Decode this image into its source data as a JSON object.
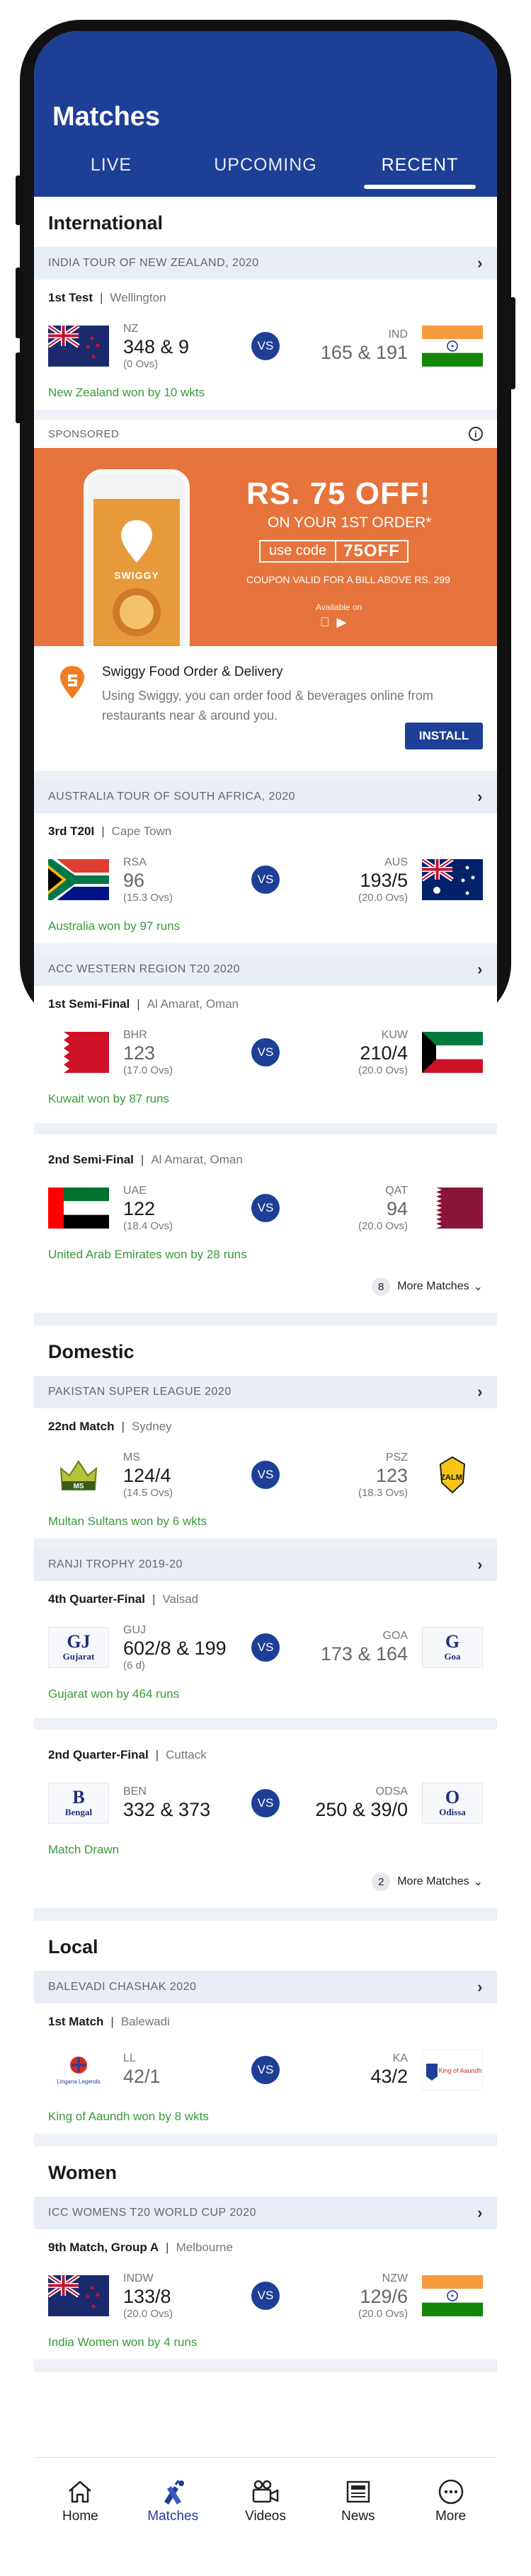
{
  "header": {
    "title": "Matches",
    "tabs": [
      "LIVE",
      "UPCOMING",
      "RECENT"
    ],
    "active_tab": "RECENT"
  },
  "sections": {
    "international": "International",
    "domestic": "Domestic",
    "local": "Local",
    "women": "Women"
  },
  "series": {
    "nz_tour": "INDIA TOUR OF NEW ZEALAND, 2020",
    "sa_tour": "AUSTRALIA TOUR OF SOUTH AFRICA, 2020",
    "acc": "ACC WESTERN REGION T20 2020",
    "psl": "PAKISTAN SUPER LEAGUE 2020",
    "ranji": "RANJI TROPHY 2019-20",
    "balewadi": "BALEVADI CHASHAK 2020",
    "icc_women": "ICC WOMENS T20 WORLD CUP 2020"
  },
  "matches": {
    "m1": {
      "name": "1st Test",
      "venue": "Wellington",
      "left_code": "NZ",
      "left_score": "348 & 9",
      "left_overs": "(0 Ovs)",
      "right_code": "IND",
      "right_score": "165 & 191",
      "right_overs": "",
      "result": "New Zealand won by 10 wkts"
    },
    "m2": {
      "name": "3rd T20I",
      "venue": "Cape Town",
      "left_code": "RSA",
      "left_score": "96",
      "left_overs": "(15.3 Ovs)",
      "right_code": "AUS",
      "right_score": "193/5",
      "right_overs": "(20.0 Ovs)",
      "result": "Australia won by 97 runs"
    },
    "m3": {
      "name": "1st Semi-Final",
      "venue": "Al Amarat, Oman",
      "left_code": "BHR",
      "left_score": "123",
      "left_overs": "(17.0 Ovs)",
      "right_code": "KUW",
      "right_score": "210/4",
      "right_overs": "(20.0 Ovs)",
      "result": "Kuwait won by 87 runs"
    },
    "m4": {
      "name": "2nd Semi-Final",
      "venue": "Al Amarat, Oman",
      "left_code": "UAE",
      "left_score": "122",
      "left_overs": "(18.4 Ovs)",
      "right_code": "QAT",
      "right_score": "94",
      "right_overs": "(20.0 Ovs)",
      "result": "United Arab Emirates won by 28 runs"
    },
    "m5": {
      "name": "22nd Match",
      "venue": "Sydney",
      "left_code": "MS",
      "left_score": "124/4",
      "left_overs": "(14.5 Ovs)",
      "right_code": "PSZ",
      "right_score": "123",
      "right_overs": "(18.3 Ovs)",
      "result": "Multan Sultans won by 6 wkts"
    },
    "m6": {
      "name": "4th Quarter-Final",
      "venue": "Valsad",
      "left_code": "GUJ",
      "left_score": "602/8 & 199",
      "left_overs": "(6 d)",
      "right_code": "GOA",
      "right_score": "173 & 164",
      "right_overs": "",
      "result": "Gujarat won by 464 runs"
    },
    "m7": {
      "name": "2nd Quarter-Final",
      "venue": "Cuttack",
      "left_code": "BEN",
      "left_score": "332 & 373",
      "left_overs": "",
      "right_code": "ODSA",
      "right_score": "250 & 39/0",
      "right_overs": "",
      "result": "Match Drawn"
    },
    "m8": {
      "name": "1st Match",
      "venue": "Balewadi",
      "left_code": "LL",
      "left_score": "42/1",
      "left_overs": "",
      "right_code": "KA",
      "right_score": "43/2",
      "right_overs": "",
      "result": "King of Aaundh won by 8 wkts"
    },
    "m9": {
      "name": "9th Match, Group A",
      "venue": "Melbourne",
      "left_code": "INDW",
      "left_score": "133/8",
      "left_overs": "(20.0 Ovs)",
      "right_code": "NZW",
      "right_score": "129/6",
      "right_overs": "(20.0 Ovs)",
      "result": "India Women won by 4 runs"
    }
  },
  "vs_label": "VS",
  "more": {
    "acc": {
      "count": "8",
      "label": "More Matches"
    },
    "ranji": {
      "count": "2",
      "label": "More Matches"
    }
  },
  "team_logos": {
    "ms": "MS",
    "psz": "ZALMI",
    "guj_big": "GJ",
    "guj_small": "Gujarat",
    "goa_big": "G",
    "goa_small": "Goa",
    "ben_big": "B",
    "ben_small": "Bengal",
    "odsa_big": "O",
    "odsa_small": "Odissa",
    "ll": "Lingana Legends",
    "ka": "King of Aaundh"
  },
  "ad": {
    "sponsored": "SPONSORED",
    "headline": "RS. 75 OFF!",
    "sub": "ON YOUR 1ST ORDER*",
    "use_code": "use code",
    "code": "75OFF",
    "fine": "COUPON VALID FOR A BILL ABOVE RS. 299",
    "available": "Available on",
    "brand": "SWIGGY",
    "app_title": "Swiggy Food Order & Delivery",
    "app_desc": "Using Swiggy, you can order food & beverages online from restaurants near & around you.",
    "install": "INSTALL"
  },
  "nav": {
    "items": [
      "Home",
      "Matches",
      "Videos",
      "News",
      "More"
    ],
    "active": "Matches"
  },
  "colors": {
    "primary": "#1e3f96",
    "result_green": "#3a9a3a",
    "ad_orange": "#e6743c"
  }
}
